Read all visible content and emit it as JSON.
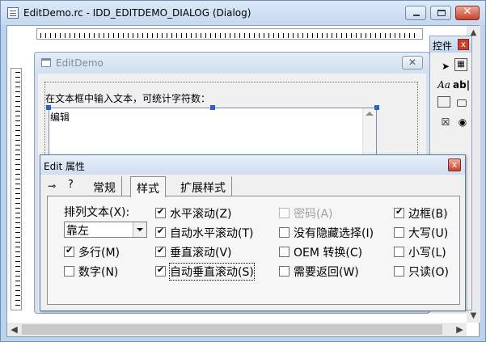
{
  "window": {
    "title": "EditDemo.rc - IDD_EDITDEMO_DIALOG (Dialog)"
  },
  "design_dialog": {
    "title": "EditDemo",
    "label": "在文本框中输入文本，可统计字符数：",
    "edit_text": "编辑"
  },
  "toolbox": {
    "title": "控件",
    "close": "x",
    "tools": [
      "pointer-icon",
      "picture-icon",
      "static-text-icon",
      "edit-box-icon",
      "group-box-icon",
      "button-icon",
      "checkbox-icon",
      "radio-button-icon"
    ]
  },
  "properties": {
    "title": "Edit 属性",
    "close": "x",
    "tabs": [
      "常规",
      "样式",
      "扩展样式"
    ],
    "active_tab": "样式",
    "align_label": "排列文本(X):",
    "align_value": "靠左",
    "checkboxes": {
      "multiline": {
        "label": "多行(M)",
        "checked": true
      },
      "number": {
        "label": "数字(N)",
        "checked": false
      },
      "hscroll": {
        "label": "水平滚动(Z)",
        "checked": true
      },
      "auto_hscroll": {
        "label": "自动水平滚动(T)",
        "checked": true
      },
      "vscroll": {
        "label": "垂直滚动(V)",
        "checked": true
      },
      "auto_vscroll": {
        "label": "自动垂直滚动(S)",
        "checked": true
      },
      "password": {
        "label": "密码(A)",
        "checked": false
      },
      "no_hide_sel": {
        "label": "没有隐藏选择(I)",
        "checked": false
      },
      "oem_convert": {
        "label": "OEM 转换(C)",
        "checked": false
      },
      "want_return": {
        "label": "需要返回(W)",
        "checked": false
      },
      "border": {
        "label": "边框(B)",
        "checked": true
      },
      "uppercase": {
        "label": "大写(U)",
        "checked": false
      },
      "lowercase": {
        "label": "小写(L)",
        "checked": false
      },
      "readonly": {
        "label": "只读(O)",
        "checked": false
      }
    }
  },
  "colors": {
    "title_bar": "#c4d8f0",
    "selection": "#2963c5",
    "close_red": "#c7412b"
  }
}
